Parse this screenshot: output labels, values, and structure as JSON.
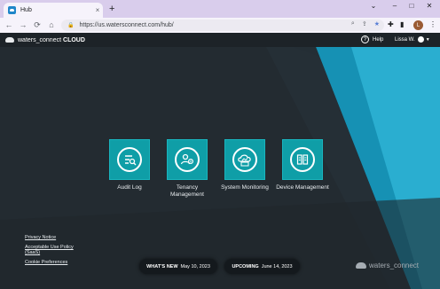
{
  "browser": {
    "tab_title": "Hub",
    "tab_close": "×",
    "new_tab": "+",
    "window": {
      "minimize": "⌄",
      "min2": "–",
      "maximize": "□",
      "close": "✕"
    },
    "nav": {
      "back": "←",
      "forward": "→",
      "reload": "⟳",
      "home": "⌂"
    },
    "url": "https://us.watersconnect.com/hub/",
    "profile_initial": "L",
    "menu": "⋮"
  },
  "app_header": {
    "brand_name": "waters_connect",
    "brand_suffix": "CLOUD",
    "help_label": "Help",
    "help_icon_glyph": "?",
    "user_name": "Lissa W.",
    "caret": "▼"
  },
  "tiles": [
    {
      "label": "Audit Log",
      "icon": "audit-log-icon"
    },
    {
      "label": "Tenancy Management",
      "icon": "tenancy-icon"
    },
    {
      "label": "System Monitoring",
      "icon": "monitoring-icon"
    },
    {
      "label": "Device Management",
      "icon": "device-icon"
    }
  ],
  "footer": {
    "links": [
      "Privacy Notice",
      "Acceptable Use Policy (SaaS)",
      "Cookie Preferences"
    ],
    "whats_new_label": "WHAT'S NEW",
    "whats_new_date": "May 10, 2023",
    "upcoming_label": "UPCOMING",
    "upcoming_date": "June 14, 2023",
    "brand": "waters_connect"
  },
  "colors": {
    "accent": "#0f9ea7",
    "header_bg": "#1d2328",
    "page_bg": "#232b31",
    "stripe": "#1691b4"
  }
}
